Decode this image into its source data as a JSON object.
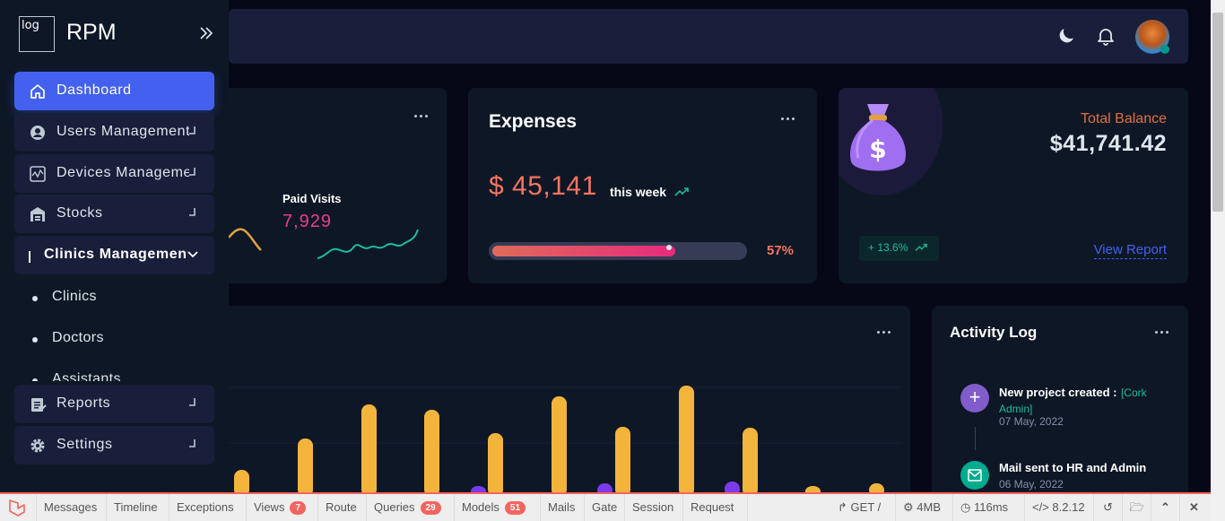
{
  "app": {
    "logo_alt": "log",
    "brand": "RPM"
  },
  "sidebar": {
    "items": [
      {
        "label": "Dashboard",
        "icon": "home-icon",
        "active": true
      },
      {
        "label": "Users Management",
        "icon": "user-circle-icon"
      },
      {
        "label": "Devices Management",
        "icon": "activity-icon"
      },
      {
        "label": "Stocks",
        "icon": "warehouse-icon"
      },
      {
        "label": "Clinics Management",
        "icon": "bar-icon",
        "expanded": true
      },
      {
        "label": "Reports",
        "icon": "clipboard-icon"
      },
      {
        "label": "Settings",
        "icon": "gear-icon"
      }
    ],
    "submenu": [
      "Clinics",
      "Doctors",
      "Assistants"
    ]
  },
  "widgets": {
    "visits": {
      "label": "Paid Visits",
      "value": "7,929"
    },
    "expenses": {
      "title": "Expenses",
      "amount": "$ 45,141",
      "period": "this week",
      "percent": "57%",
      "progress": 0.57
    },
    "balance": {
      "label": "Total Balance",
      "value": "$41,741.42",
      "change": "+ 13.6%",
      "link": "View Report"
    },
    "activity": {
      "title": "Activity Log",
      "entries": [
        {
          "text": "New project created :",
          "tag": "[Cork Admin]",
          "date": "07 May, 2022"
        },
        {
          "text": "Mail sent to HR and Admin",
          "date": "06 May, 2022"
        }
      ]
    }
  },
  "debugbar": {
    "tabs": [
      {
        "label": "Messages"
      },
      {
        "label": "Timeline"
      },
      {
        "label": "Exceptions"
      },
      {
        "label": "Views",
        "badge": "7"
      },
      {
        "label": "Route"
      },
      {
        "label": "Queries",
        "badge": "29"
      },
      {
        "label": "Models",
        "badge": "51"
      },
      {
        "label": "Mails"
      },
      {
        "label": "Gate"
      },
      {
        "label": "Session"
      },
      {
        "label": "Request"
      }
    ],
    "method": "GET /",
    "memory": "4MB",
    "time": "116ms",
    "php": "8.2.12"
  },
  "colors": {
    "accent": "#4361ee",
    "orange": "#e7515a",
    "pink": "#ff2d87",
    "teal": "#00ab55",
    "gold": "#e2a03f",
    "bar": "#f3b43c"
  }
}
